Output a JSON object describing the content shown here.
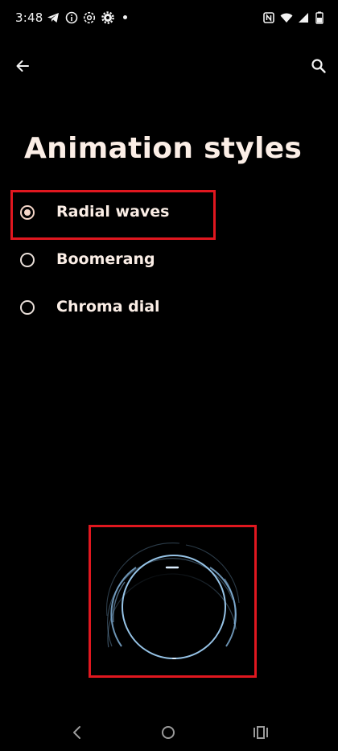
{
  "status_bar": {
    "time": "3:48",
    "icons": [
      "telegram-icon",
      "info-icon",
      "settings-outline-icon",
      "gear-icon",
      "nfc-icon",
      "wifi-icon",
      "signal-icon",
      "battery-icon"
    ]
  },
  "app_bar": {
    "back_icon": "arrow-left-icon",
    "search_icon": "search-icon"
  },
  "page": {
    "title": "Animation styles"
  },
  "options": [
    {
      "label": "Radial waves",
      "selected": true
    },
    {
      "label": "Boomerang",
      "selected": false
    },
    {
      "label": "Chroma dial",
      "selected": false
    }
  ],
  "preview": {
    "name": "radial-waves-preview",
    "ring_color": "#8fc3ee"
  },
  "nav_bar": {
    "icons": [
      "nav-back-icon",
      "nav-home-icon",
      "nav-recents-icon"
    ]
  },
  "colors": {
    "background": "#000000",
    "text": "#fbeee6",
    "highlight": "#e0171f",
    "radio_selected": "#f4d6c8"
  }
}
